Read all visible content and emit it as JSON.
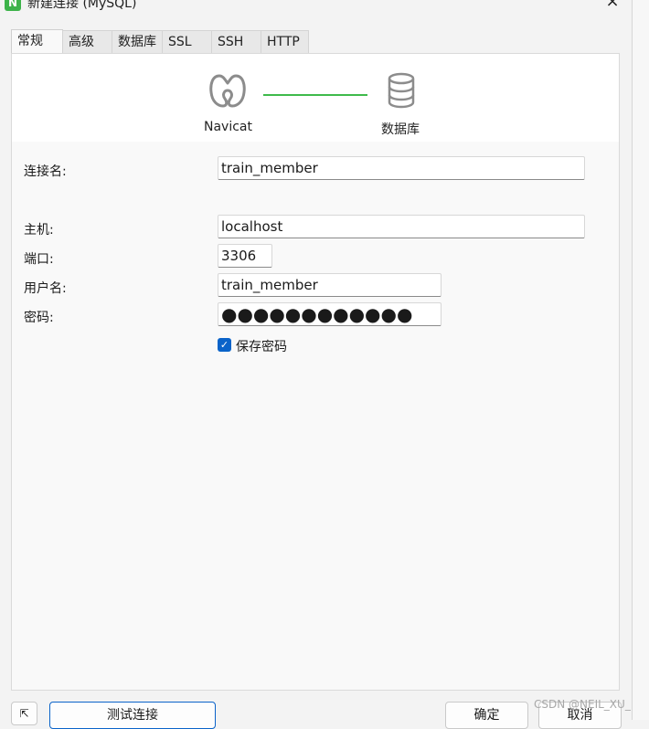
{
  "window": {
    "title": "新建连接 (MySQL)",
    "close_icon": "×",
    "app_icon_glyph": "N"
  },
  "tabs": [
    {
      "label": "常规",
      "active": true
    },
    {
      "label": "高级",
      "active": false
    },
    {
      "label": "数据库",
      "active": false
    },
    {
      "label": "SSL",
      "active": false
    },
    {
      "label": "SSH",
      "active": false
    },
    {
      "label": "HTTP",
      "active": false
    }
  ],
  "banner": {
    "left_label": "Navicat",
    "right_label": "数据库",
    "line_color": "#3fba4b"
  },
  "form": {
    "connection_name": {
      "label": "连接名:",
      "value": "train_member"
    },
    "host": {
      "label": "主机:",
      "value": "localhost"
    },
    "port": {
      "label": "端口:",
      "value": "3306"
    },
    "username": {
      "label": "用户名:",
      "value": "train_member"
    },
    "password": {
      "label": "密码:",
      "value": "●●●●●●●●●●●●"
    },
    "save_password": {
      "label": "保存密码",
      "checked": true
    }
  },
  "footer": {
    "test_connection_label": "测试连接",
    "ok_label": "确定",
    "cancel_label": "取消"
  },
  "watermark": "CSDN @NEIL_XU_",
  "colors": {
    "accent": "#0a63c9",
    "success": "#3fba4b"
  }
}
